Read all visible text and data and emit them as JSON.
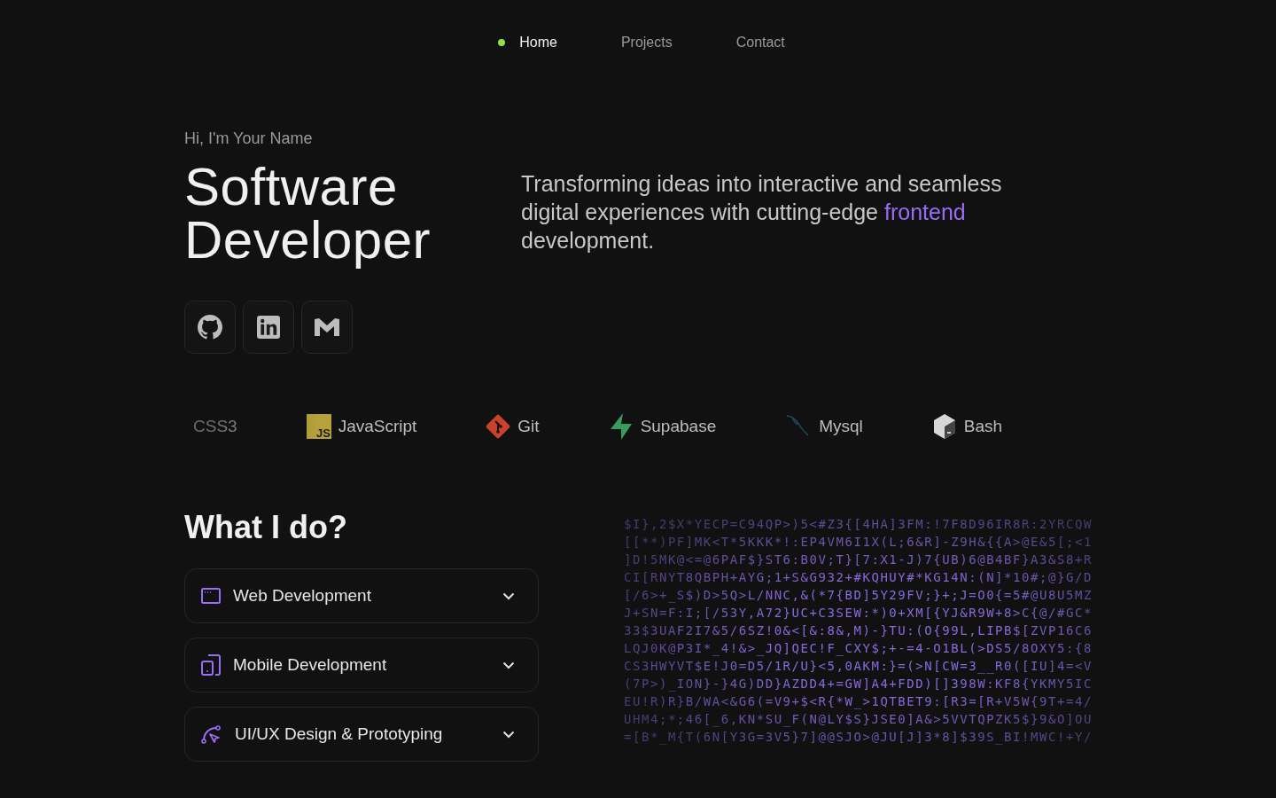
{
  "nav": [
    {
      "label": "Home",
      "selected": true
    },
    {
      "label": "Projects",
      "selected": false
    },
    {
      "label": "Contact",
      "selected": false
    }
  ],
  "hero": {
    "greeting": "Hi, I'm Your Name",
    "title": "Software Developer",
    "description": [
      {
        "text": "Transforming ideas into interactive and seamless digital experiences with cutting-edge ",
        "highlight": false
      },
      {
        "text": "frontend",
        "highlight": true
      },
      {
        "text": " development.",
        "highlight": false
      }
    ],
    "socials": [
      {
        "kind": "github"
      },
      {
        "kind": "linkedin"
      },
      {
        "kind": "gmail"
      }
    ]
  },
  "tech": [
    {
      "kind": "css",
      "label": "CSS3"
    },
    {
      "kind": "js",
      "label": "JavaScript",
      "badge": "JS"
    },
    {
      "kind": "git",
      "label": "Git"
    },
    {
      "kind": "supabase",
      "label": "Supabase"
    },
    {
      "kind": "mysql",
      "label": "Mysql"
    },
    {
      "kind": "bash",
      "label": "Bash"
    }
  ],
  "services": {
    "title": "What I do?",
    "items": [
      {
        "kind": "web",
        "label": "Web Development",
        "expanded": false
      },
      {
        "kind": "mobile",
        "label": "Mobile Development",
        "expanded": false
      },
      {
        "kind": "design",
        "label": "UI/UX Design & Prototyping",
        "expanded": false
      }
    ]
  },
  "matrix": [
    "$I},2$X*YECP=C94QP>)5<#Z3{[4HA]3FM:!7F8D96IR8R:2YRCQW",
    "[[**)PF]MK<T*5KKK*!:EP4VM6I1X(L;6&R]-Z9H&{{A>@E&5[;<1",
    "]D!5MK@<=@6PAF$}ST6:B0V;T}[7:X1-J)7{UB)6@B4BF}A3&S8+R",
    "CI[RNYT8QBPH+AYG;1+S&G932+#KQHUY#*KG14N:(N]*10#;@}G/D",
    "[/6>+_S$)D>5Q>L/NNC,&(*7{BD]5Y29FV;}+;J=O0{=5#@U8U5MZ",
    "J+SN=F:I;[/53Y,A72}UC+C3SEW:*)0+XM[{YJ&R9W+8>C{@/#GC*",
    "33$3UAF2I7&5/6SZ!0&<[&:8&,M)-}TU:(O{99L,LIPB$[ZVP16C6",
    "LQJ0K@P3I*_4!&>_JQ]QEC!F_CXY$;+-=4-O1BL(>DS5/8OXY5:{8",
    "CS3HWYVT$E!J0=D5/1R/U}<5,0AKM:}=(>N[CW=3__R0([IU]4=<V",
    "(7P>)_ION}-}4G)DD}AZDD4+=GW]A4+FDD)[]398W:KF8{YKMY5IC",
    "EU!R)R}B/WA<&G6(=V9+$<R{*W_>1QTBET9:[R3=[R+V5W{9T+=4/",
    "UHM4;*;46[_6,KN*SU_F(N@LY$S}JSE0]A&>5VVTQPZK5$}9&O]OU",
    "=[B*_M{T(6N[Y3G=3V5}7]@@SJO>@JU[J]3*8]$39S_BI!MWC!+Y/"
  ]
}
